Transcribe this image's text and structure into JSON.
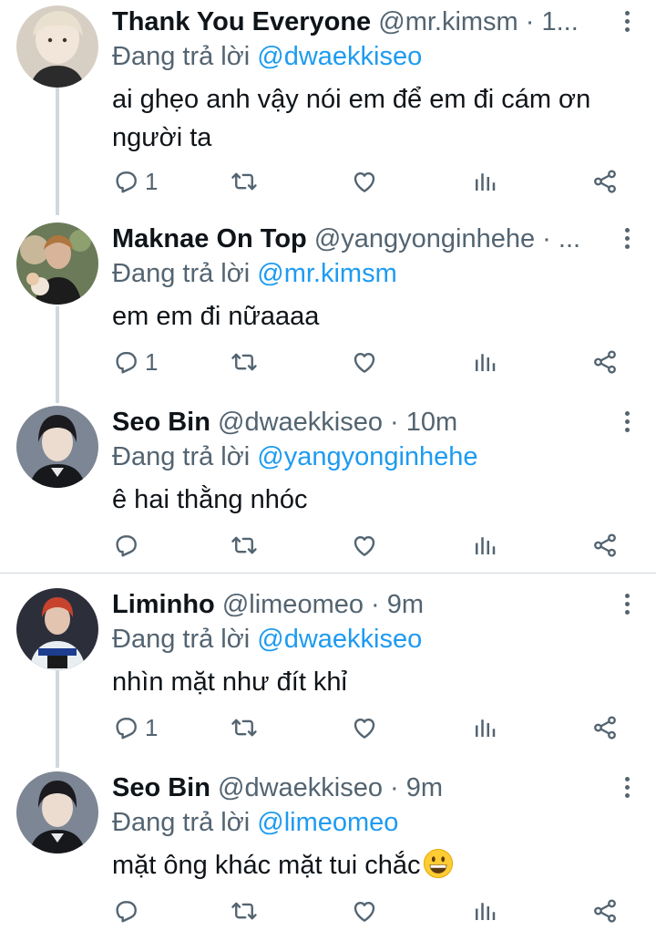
{
  "tweets": [
    {
      "name": "Thank You Everyone",
      "handle": "@mr.kimsm · 1...",
      "reply_prefix": "Đang trả lời",
      "reply_to": "@dwaekkiseo",
      "text": "ai ghẹo anh vậy nói em để em đi cám ơn người ta",
      "reply_count": "1"
    },
    {
      "name": "Maknae On Top",
      "handle": "@yangyonginhehe · ...",
      "reply_prefix": "Đang trả lời",
      "reply_to": "@mr.kimsm",
      "text": "em em đi nữaaaa",
      "reply_count": "1"
    },
    {
      "name": "Seo Bin",
      "handle": "@dwaekkiseo · 10m",
      "reply_prefix": "Đang trả lời",
      "reply_to": "@yangyonginhehe",
      "text": "ê hai thằng nhóc",
      "reply_count": ""
    },
    {
      "name": "Liminho",
      "handle": "@limeomeo · 9m",
      "reply_prefix": "Đang trả lời",
      "reply_to": "@dwaekkiseo",
      "text": "nhìn mặt như đít khỉ",
      "reply_count": "1"
    },
    {
      "name": "Seo Bin",
      "handle": "@dwaekkiseo · 9m",
      "reply_prefix": "Đang trả lời",
      "reply_to": "@limeomeo",
      "text": "mặt ông khác mặt tui chắc",
      "text_emoji": "grinning-face-emoji",
      "reply_count": ""
    }
  ],
  "colors": {
    "accent": "#1d9bf0",
    "secondary_text": "#536471",
    "thread_line": "#cfd9de"
  },
  "icons": {
    "reply": "reply-icon",
    "retweet": "retweet-icon",
    "like": "heart-icon",
    "analytics": "analytics-icon",
    "share": "share-icon",
    "more": "more-vertical-icon"
  }
}
